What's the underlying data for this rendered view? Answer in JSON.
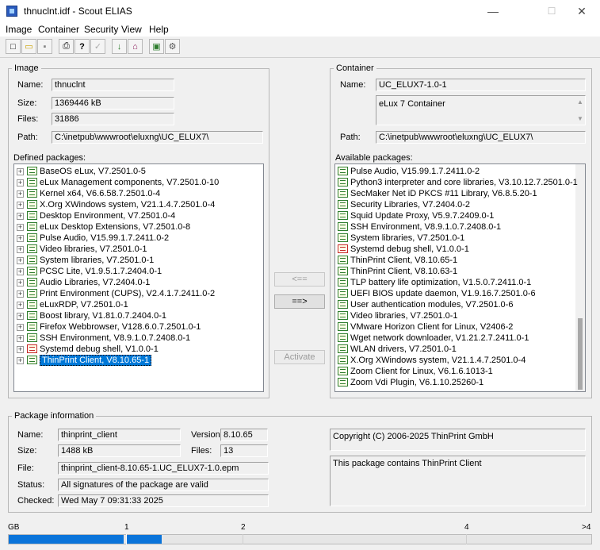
{
  "window": {
    "title": "thnuclnt.idf - Scout ELIAS",
    "minimize": "—",
    "maximize": "☐",
    "close": "✕"
  },
  "menu": [
    "Image",
    "Container",
    "Security",
    "View",
    "Help"
  ],
  "toolbar": [
    "new-icon",
    "open-icon",
    "save-icon",
    "print-icon",
    "help-icon",
    "security-disabled-icon",
    "import-icon",
    "export-icon",
    "image-icon",
    "settings-icon"
  ],
  "image": {
    "group_title": "Image",
    "name_label": "Name:",
    "name": "thnuclnt",
    "size_label": "Size:",
    "size": "1369446 kB",
    "files_label": "Files:",
    "files": "31886",
    "path_label": "Path:",
    "path": "C:\\inetpub\\wwwroot\\eluxng\\UC_ELUX7\\"
  },
  "container": {
    "group_title": "Container",
    "name_label": "Name:",
    "name": "UC_ELUX7-1.0-1",
    "description": "eLux 7 Container",
    "path_label": "Path:",
    "path": "C:\\inetpub\\wwwroot\\eluxng\\UC_ELUX7\\"
  },
  "defined": {
    "label": "Defined packages:",
    "items": [
      {
        "text": "BaseOS eLux, V7.2501.0-5",
        "status": "ok"
      },
      {
        "text": "eLux Management components, V7.2501.0-10",
        "status": "ok"
      },
      {
        "text": "Kernel x64, V6.6.58.7.2501.0-4",
        "status": "ok"
      },
      {
        "text": "X.Org XWindows system, V21.1.4.7.2501.0-4",
        "status": "ok"
      },
      {
        "text": "Desktop Environment, V7.2501.0-4",
        "status": "ok"
      },
      {
        "text": "eLux Desktop Extensions, V7.2501.0-8",
        "status": "ok"
      },
      {
        "text": "Pulse Audio, V15.99.1.7.2411.0-2",
        "status": "ok"
      },
      {
        "text": "Video libraries, V7.2501.0-1",
        "status": "ok"
      },
      {
        "text": "System libraries, V7.2501.0-1",
        "status": "ok"
      },
      {
        "text": "PCSC Lite, V1.9.5.1.7.2404.0-1",
        "status": "ok"
      },
      {
        "text": "Audio Libraries, V7.2404.0-1",
        "status": "ok"
      },
      {
        "text": "Print Environment (CUPS), V2.4.1.7.2411.0-2",
        "status": "ok"
      },
      {
        "text": "eLuxRDP, V7.2501.0-1",
        "status": "ok"
      },
      {
        "text": "Boost library, V1.81.0.7.2404.0-1",
        "status": "ok"
      },
      {
        "text": "Firefox Webbrowser, V128.6.0.7.2501.0-1",
        "status": "ok"
      },
      {
        "text": "SSH Environment, V8.9.1.0.7.2408.0-1",
        "status": "ok"
      },
      {
        "text": "Systemd debug shell, V1.0.0-1",
        "status": "error"
      },
      {
        "text": "ThinPrint Client, V8.10.65-1",
        "status": "ok",
        "selected": true
      }
    ]
  },
  "available": {
    "label": "Available packages:",
    "items": [
      {
        "text": "Pulse Audio, V15.99.1.7.2411.0-2",
        "status": "ok"
      },
      {
        "text": "Python3 interpreter and core libraries, V3.10.12.7.2501.0-1",
        "status": "ok"
      },
      {
        "text": "SecMaker Net iD PKCS #11 Library, V6.8.5.20-1",
        "status": "ok"
      },
      {
        "text": "Security Libraries, V7.2404.0-2",
        "status": "ok"
      },
      {
        "text": "Squid Update Proxy, V5.9.7.2409.0-1",
        "status": "ok"
      },
      {
        "text": "SSH Environment, V8.9.1.0.7.2408.0-1",
        "status": "ok"
      },
      {
        "text": "System libraries, V7.2501.0-1",
        "status": "ok"
      },
      {
        "text": "Systemd debug shell, V1.0.0-1",
        "status": "error"
      },
      {
        "text": "ThinPrint Client, V8.10.65-1",
        "status": "ok"
      },
      {
        "text": "ThinPrint Client, V8.10.63-1",
        "status": "ok"
      },
      {
        "text": "TLP battery life optimization, V1.5.0.7.2411.0-1",
        "status": "ok"
      },
      {
        "text": "UEFI BIOS update daemon, V1.9.16.7.2501.0-6",
        "status": "ok"
      },
      {
        "text": "User authentication modules, V7.2501.0-6",
        "status": "ok"
      },
      {
        "text": "Video libraries, V7.2501.0-1",
        "status": "ok"
      },
      {
        "text": "VMware Horizon Client for Linux, V2406-2",
        "status": "ok"
      },
      {
        "text": "Wget network downloader, V1.21.2.7.2411.0-1",
        "status": "ok"
      },
      {
        "text": "WLAN drivers, V7.2501.0-1",
        "status": "ok"
      },
      {
        "text": "X.Org XWindows system, V21.1.4.7.2501.0-4",
        "status": "ok"
      },
      {
        "text": "Zoom Client for Linux, V6.1.6.1013-1",
        "status": "ok"
      },
      {
        "text": "Zoom Vdi Plugin, V6.1.10.25260-1",
        "status": "ok"
      }
    ]
  },
  "buttons": {
    "remove": "<==",
    "add": "==>",
    "activate": "Activate"
  },
  "package_info": {
    "group_title": "Package information",
    "name_label": "Name:",
    "name": "thinprint_client",
    "version_label": "Version:",
    "version": "8.10.65",
    "size_label": "Size:",
    "size": "1488 kB",
    "files_label": "Files:",
    "files": "13",
    "file_label": "File:",
    "file": "thinprint_client-8.10.65-1.UC_ELUX7-1.0.epm",
    "status_label": "Status:",
    "status": "All signatures of the package are valid",
    "checked_label": "Checked:",
    "checked": "Wed May  7 09:31:33 2025",
    "copyright": "Copyright (C) 2006-2025 ThinPrint GmbH",
    "description": "This package contains ThinPrint Client"
  },
  "usage_bar": {
    "ticks": [
      "GB",
      "1",
      "2",
      "4",
      ">4"
    ],
    "used_gb": 1.31
  },
  "colors": {
    "selection": "#0078d7",
    "ok_icon": "#2e7d2e",
    "error_icon": "#c62828",
    "bar": "#0a74da"
  }
}
